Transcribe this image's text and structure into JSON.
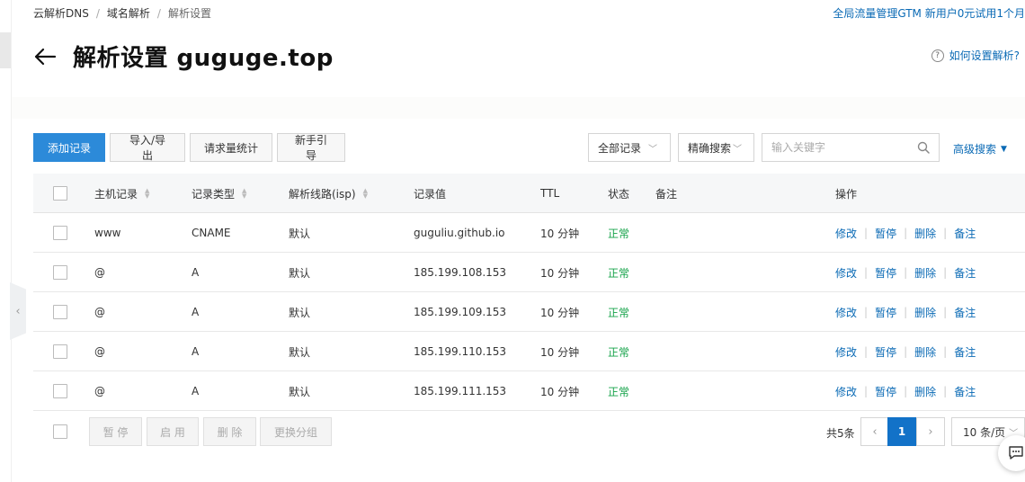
{
  "breadcrumb": [
    "云解析DNS",
    "域名解析",
    "解析设置"
  ],
  "promo": "全局流量管理GTM 新用户0元试用1个月",
  "title": "解析设置 guguge.top",
  "help": "如何设置解析?",
  "toolbar": {
    "add": "添加记录",
    "import_export": "导入/导出",
    "stats": "请求量统计",
    "guide": "新手引导"
  },
  "filters": {
    "record_filter": "全部记录",
    "search_mode": "精确搜索",
    "search_placeholder": "输入关键字",
    "advanced": "高级搜索"
  },
  "table": {
    "headers": {
      "host": "主机记录",
      "type": "记录类型",
      "line": "解析线路(isp)",
      "value": "记录值",
      "ttl": "TTL",
      "status": "状态",
      "remark": "备注",
      "ops": "操作"
    },
    "rows": [
      {
        "host": "www",
        "type": "CNAME",
        "line": "默认",
        "value": "guguliu.github.io",
        "ttl": "10 分钟",
        "status": "正常",
        "remark": ""
      },
      {
        "host": "@",
        "type": "A",
        "line": "默认",
        "value": "185.199.108.153",
        "ttl": "10 分钟",
        "status": "正常",
        "remark": ""
      },
      {
        "host": "@",
        "type": "A",
        "line": "默认",
        "value": "185.199.109.153",
        "ttl": "10 分钟",
        "status": "正常",
        "remark": ""
      },
      {
        "host": "@",
        "type": "A",
        "line": "默认",
        "value": "185.199.110.153",
        "ttl": "10 分钟",
        "status": "正常",
        "remark": ""
      },
      {
        "host": "@",
        "type": "A",
        "line": "默认",
        "value": "185.199.111.153",
        "ttl": "10 分钟",
        "status": "正常",
        "remark": ""
      }
    ],
    "ops": {
      "edit": "修改",
      "pause": "暂停",
      "delete": "删除",
      "note": "备注"
    }
  },
  "bulk": {
    "pause": "暂 停",
    "enable": "启 用",
    "delete": "删 除",
    "change_group": "更换分组"
  },
  "pagination": {
    "total": "共5条",
    "current_page": "1",
    "page_size": "10 条/页"
  },
  "colors": {
    "primary": "#2c8ad9",
    "link": "#0a6ab5",
    "status_ok": "#16a34a"
  },
  "icons": [
    "back-arrow-icon",
    "help-icon",
    "search-icon",
    "caret-down-icon",
    "sort-icon",
    "chevron-left-icon",
    "chevron-right-icon",
    "chat-icon"
  ]
}
